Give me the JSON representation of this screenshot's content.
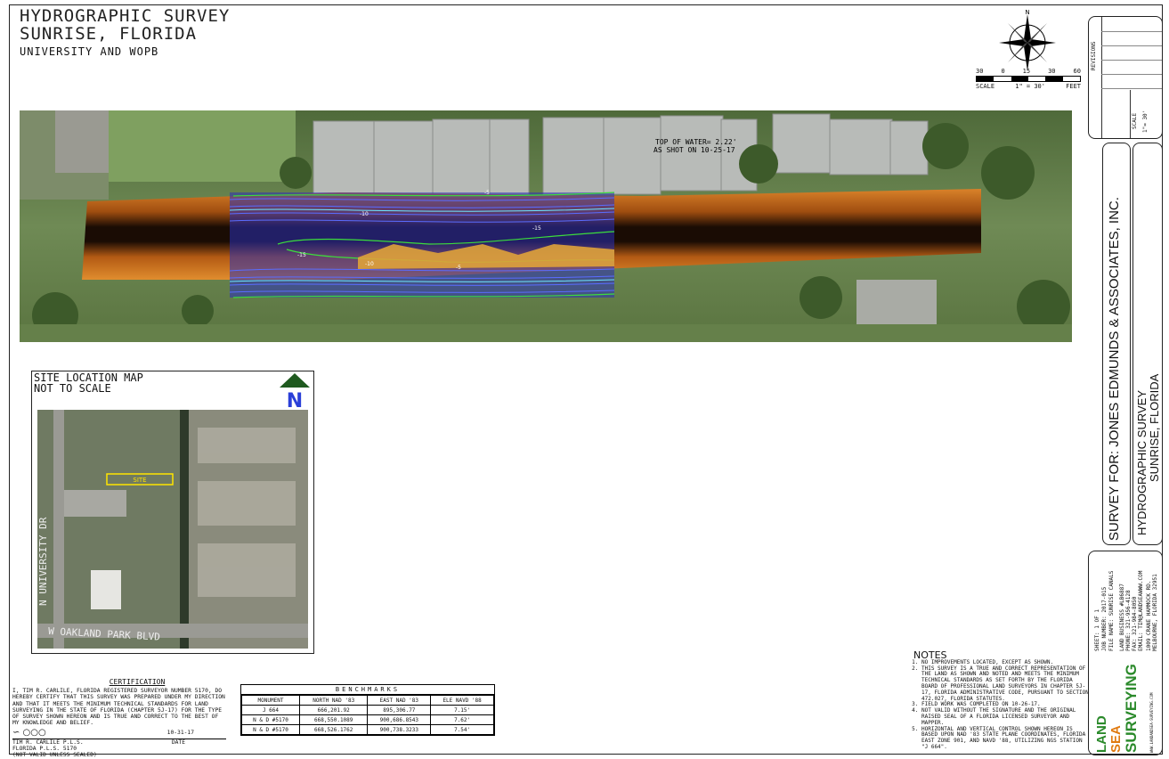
{
  "header": {
    "line1": "HYDROGRAPHIC SURVEY",
    "line2": "SUNRISE, FLORIDA",
    "line3": "UNIVERSITY AND WOPB"
  },
  "scale": {
    "nums": [
      "30",
      "0",
      "15",
      "30",
      "60"
    ],
    "label": "SCALE",
    "ratio": "1\" = 30'",
    "unit": "FEET",
    "north": "N"
  },
  "aerial": {
    "top_of_water_1": "TOP OF WATER= 2.22'",
    "top_of_water_2": "AS SHOT ON 10-25-17",
    "contour_labels": [
      "-5",
      "-10",
      "-15",
      "-15",
      "-10",
      "-5"
    ]
  },
  "site_map": {
    "title1": "SITE LOCATION MAP",
    "title2": "NOT TO SCALE",
    "north": "N",
    "site_label": "SITE",
    "road1": "N UNIVERSITY DR",
    "road2": "W OAKLAND PARK BLVD"
  },
  "certification": {
    "heading": "CERTIFICATION",
    "body": "I, TIM R. CARLILE, FLORIDA REGISTERED SURVEYOR NUMBER 5170, DO HEREBY CERTIFY THAT THIS SURVEY WAS PREPARED UNDER MY DIRECTION AND THAT IT MEETS THE MINIMUM TECHNICAL STANDARDS FOR LAND SURVEYING IN THE STATE OF FLORIDA (CHAPTER 5J-17) FOR THE TYPE OF SURVEY SHOWN HEREON AND IS TRUE AND CORRECT TO THE BEST OF MY KNOWLEDGE AND BELIEF.",
    "date": "10-31-17",
    "name": "TIM R. CARLILE P.L.S.",
    "reg": "FLORIDA P.L.S. 5170",
    "date_label": "DATE",
    "not_valid": "(NOT VALID UNLESS SEALED)"
  },
  "benchmarks": {
    "title": "BENCHMARKS",
    "columns": [
      "MONUMENT",
      "NORTH NAD '83",
      "EAST NAD '83",
      "ELE NAVD '88"
    ],
    "rows": [
      [
        "J 664",
        "666,201.92",
        "895,306.77",
        "7.15'"
      ],
      [
        "N & D #5170",
        "668,550.1089",
        "900,686.8543",
        "7.62'"
      ],
      [
        "N & D #5170",
        "668,526.1762",
        "900,738.3233",
        "7.54'"
      ]
    ]
  },
  "notes": {
    "heading": "NOTES",
    "items": [
      "NO IMPROVEMENTS LOCATED, EXCEPT AS SHOWN.",
      "THIS SURVEY IS A TRUE AND CORRECT REPRESENTATION OF THE LAND AS SHOWN AND NOTED AND MEETS THE MINIMUM TECHNICAL STANDARDS AS SET FORTH BY THE FLORIDA BOARD OF PROFESSIONAL LAND SURVEYORS IN CHAPTER 5J-17, FLORIDA ADMINISTRATIVE CODE, PURSUANT TO SECTION 472.027, FLORIDA STATUTES.",
      "FIELD WORK WAS COMPLETED ON 10-26-17.",
      "NOT VALID WITHOUT THE SIGNATURE AND THE ORIGINAL RAISED SEAL OF A FLORIDA LICENSED SURVEYOR AND MAPPER.",
      "HORIZONTAL AND VERTICAL CONTROL SHOWN HEREON IS BASED UPON NAD '83 STATE PLANE COORDINATES, FLORIDA EAST ZONE 901, AND NAVD '88, UTILIZING NGS STATION \"J 664\"."
    ]
  },
  "title_block": {
    "revisions": "REVISIONS",
    "scale_label": "SCALE",
    "scale_value": "1\"= 30'",
    "survey_for": "SURVEY FOR: JONES EDMUNDS & ASSOCIATES, INC.",
    "project1": "HYDROGRAPHIC SURVEY",
    "project2": "SUNRISE, FLORIDA",
    "sheet": "SHEET:  1 OF 1",
    "job": "JOB NUMBER:  2017-015",
    "file": "FILE NAME:  SUNRISE CANALS",
    "lb": "LAND BUSINESS #LB6887",
    "phone": "PHONE: 321-956-4128",
    "fax": "FAX: 321-984-8050",
    "email": "EMAIL: TIM@LANDSEAWWW.COM",
    "addr1": "1009 CRANE HAMMOCK RD.",
    "addr2": "MELBOURNE, FLORIDA 32951",
    "logo1": "LAND",
    "logo2": "SEA",
    "logo3": "SURVEYING",
    "website": "WWW.LANDANDSEA-SURVEYING.COM"
  }
}
